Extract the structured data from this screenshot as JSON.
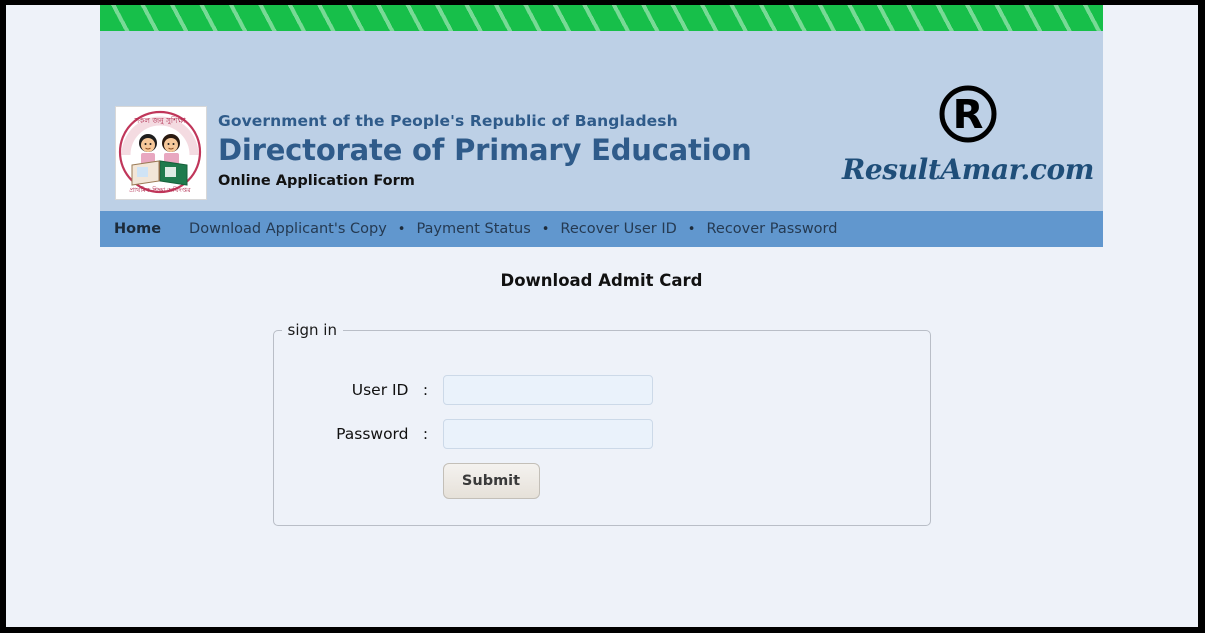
{
  "header": {
    "gov_line": "Government of the People's Republic of Bangladesh",
    "org_line": "Directorate of Primary Education",
    "form_line": "Online Application Form",
    "logo_alt": "dpe-emblem-two-children-reading",
    "brand_name": "ResultAmar.com",
    "brand_mark": "registered-r-icon",
    "colors": {
      "header_bg": "#bdd0e6",
      "nav_bg": "#6197ce",
      "green_bar": "#17bf4a",
      "title_blue": "#2f5b8a",
      "brand_blue": "#1f4e79",
      "page_bg": "#eef2f9"
    }
  },
  "nav": {
    "home_label": "Home",
    "separator": "•",
    "links": [
      {
        "label": "Download Applicant's Copy"
      },
      {
        "label": "Payment Status"
      },
      {
        "label": "Recover User ID"
      },
      {
        "label": "Recover Password"
      }
    ]
  },
  "main": {
    "page_title": "Download Admit Card",
    "fieldset_legend": "sign in",
    "fields": [
      {
        "label": "User ID",
        "colon": ":",
        "value": "",
        "placeholder": ""
      },
      {
        "label": "Password",
        "colon": ":",
        "value": "",
        "placeholder": ""
      }
    ],
    "submit_label": "Submit"
  }
}
